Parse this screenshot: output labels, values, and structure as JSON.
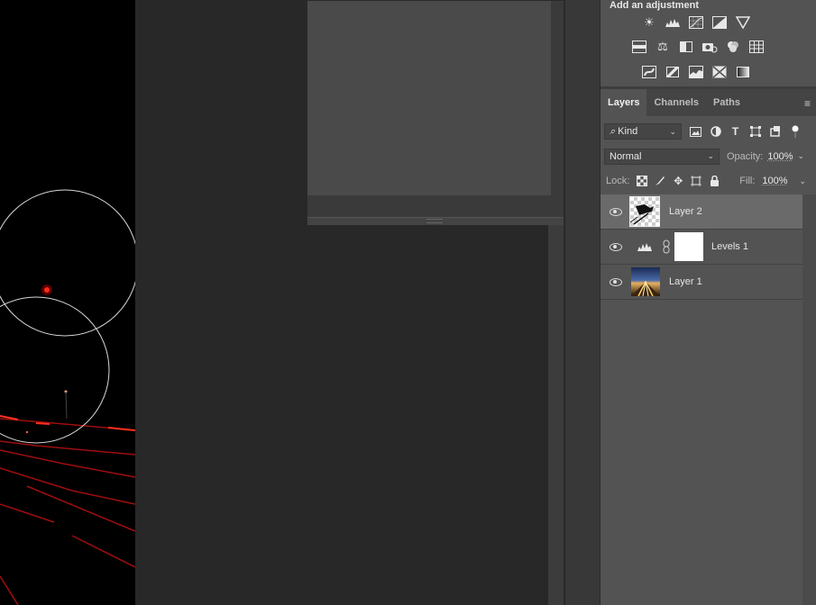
{
  "adjustments": {
    "title": "Add an adjustment",
    "rows": [
      [
        "brightness-contrast-icon",
        "levels-icon",
        "curves-icon",
        "exposure-icon",
        "vibrance-icon"
      ],
      [
        "hue-saturation-icon",
        "color-balance-icon",
        "black-white-icon",
        "photo-filter-icon",
        "channel-mixer-icon",
        "color-lookup-icon"
      ],
      [
        "invert-icon",
        "posterize-icon",
        "threshold-icon",
        "selective-color-icon",
        "gradient-map-icon"
      ]
    ]
  },
  "layers_panel": {
    "tabs": [
      "Layers",
      "Channels",
      "Paths"
    ],
    "active_tab": "Layers",
    "filter": {
      "kind_label": "Kind"
    },
    "blend_mode": "Normal",
    "opacity_label": "Opacity:",
    "opacity_value": "100%",
    "lock_label": "Lock:",
    "fill_label": "Fill:",
    "fill_value": "100%",
    "layers": [
      {
        "name": "Layer 2",
        "selected": true
      },
      {
        "name": "Levels 1",
        "selected": false
      },
      {
        "name": "Layer 1",
        "selected": false
      }
    ]
  },
  "colors": {
    "panel_bg": "#535353",
    "selected_layer": "#6a6a6a",
    "workspace": "#282828",
    "light_red": "#ff2a1a"
  }
}
